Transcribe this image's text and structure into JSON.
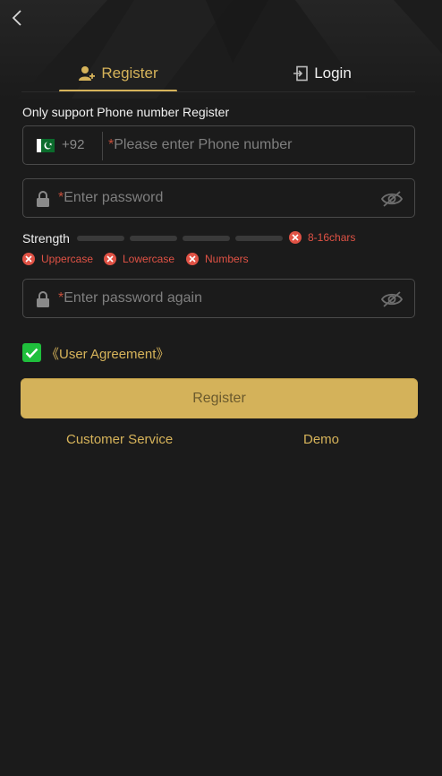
{
  "tabs": {
    "register_label": "Register",
    "login_label": "Login",
    "active": "Register"
  },
  "form": {
    "section_label": "Only support Phone number Register",
    "phone": {
      "country_code": "+92",
      "required_mark": "*",
      "placeholder": "Please enter Phone number",
      "value": ""
    },
    "password": {
      "required_mark": "*",
      "placeholder": "Enter password",
      "value": ""
    },
    "strength": {
      "label": "Strength",
      "level": 0,
      "bars": 4,
      "length_rule": "8-16chars",
      "rules": [
        "Uppercase",
        "Lowercase",
        "Numbers"
      ],
      "rule_status_color": "#e05245"
    },
    "confirm_password": {
      "required_mark": "*",
      "placeholder": "Enter password again",
      "value": ""
    },
    "agreement": {
      "checked": true,
      "label": "《User Agreement》"
    },
    "submit_label": "Register"
  },
  "footer": {
    "customer_service": "Customer Service",
    "demo": "Demo"
  },
  "colors": {
    "accent": "#d6b35a",
    "background": "#1b1b1b",
    "checkbox": "#1fbf3c",
    "error": "#e05245"
  },
  "icons": {
    "back": "chevron-left-icon",
    "register_tab": "user-add-icon",
    "login_tab": "login-icon",
    "flag": "pakistan-flag-icon",
    "lock": "lock-icon",
    "eye": "eye-off-icon",
    "error": "x-circle-icon",
    "check": "check-icon"
  }
}
